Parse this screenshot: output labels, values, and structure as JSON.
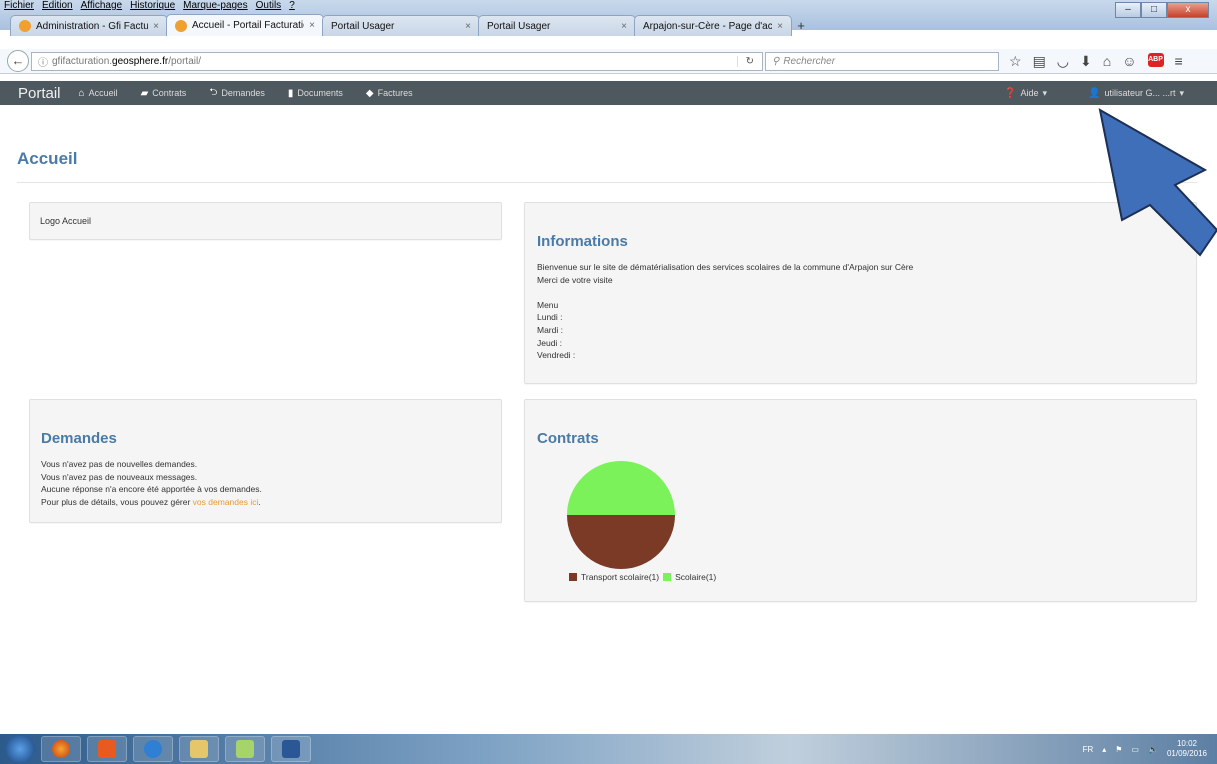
{
  "browser": {
    "menu": [
      "Fichier",
      "Édition",
      "Affichage",
      "Historique",
      "Marque-pages",
      "Outils",
      "?"
    ],
    "tabs": [
      {
        "label": "Administration - Gfi Factur...",
        "close": "×"
      },
      {
        "label": "Accueil - Portail Facturation",
        "close": "×"
      },
      {
        "label": "Portail Usager",
        "close": "×"
      },
      {
        "label": "Portail Usager",
        "close": "×"
      },
      {
        "label": "Arpajon-sur-Cère - Page d'acc...",
        "close": "×"
      }
    ],
    "new_tab": "+",
    "url_prefix": "gfifacturation.",
    "url_host": "geosphere.fr",
    "url_path": "/portail/",
    "search_placeholder": "Rechercher"
  },
  "appnav": {
    "brand": "Portail",
    "items": [
      "Accueil",
      "Contrats",
      "Demandes",
      "Documents",
      "Factures"
    ],
    "help": "Aide",
    "user": "utilisateur G... ...rt"
  },
  "page": {
    "title": "Accueil",
    "logo_panel": "Logo Accueil",
    "info": {
      "title": "Informations",
      "line1": "Bienvenue sur le site de dématérialisation des services scolaires de la commune d'Arpajon sur Cère",
      "line2": "Merci de votre visite",
      "menu": "Menu",
      "days": [
        "Lundi :",
        "Mardi :",
        "Jeudi :",
        "Vendredi :"
      ]
    },
    "demandes": {
      "title": "Demandes",
      "lines": [
        "Vous n'avez pas de nouvelles demandes.",
        "Vous n'avez pas de nouveaux messages.",
        "Aucune réponse n'a encore été apportée à vos demandes."
      ],
      "details_prefix": "Pour plus de détails, vous pouvez gérer ",
      "details_link": "vos demandes ici",
      "details_suffix": "."
    },
    "contrats": {
      "title": "Contrats"
    }
  },
  "chart_data": {
    "type": "pie",
    "labels": [
      "Transport scolaire",
      "Scolaire"
    ],
    "values": [
      1,
      1
    ],
    "legend": [
      "Transport scolaire(1)",
      "Scolaire(1)"
    ],
    "colors": [
      "#7a3a26",
      "#7cf25a"
    ]
  },
  "taskbar": {
    "lang": "FR",
    "time": "10:02",
    "date": "01/09/2016"
  }
}
